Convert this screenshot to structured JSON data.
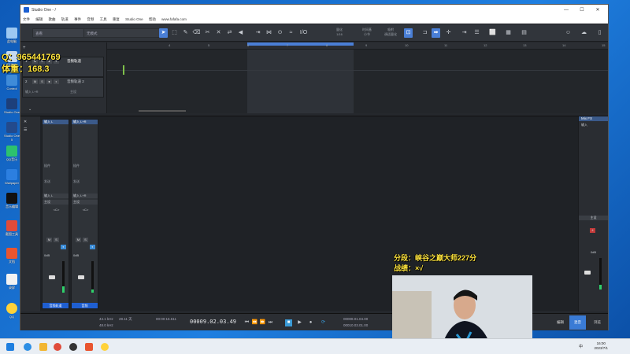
{
  "window": {
    "title": "Studio One - /",
    "min": "—",
    "max": "☐",
    "close": "✕"
  },
  "menu": [
    "文件",
    "编辑",
    "歌曲",
    "轨道",
    "事件",
    "音频",
    "工具",
    "重复",
    "Studio One",
    "帮助",
    "www.fafafa.com"
  ],
  "toolbar": {
    "field1": "查看",
    "field2": "无模式",
    "quant_label": "量化",
    "quant_value": "1/16",
    "timebase_label": "时间基",
    "timebase_value": "小节",
    "snap_label": "吸附",
    "snap_value": "调适量化"
  },
  "ruler": {
    "ticks": [
      "4",
      "5",
      "6",
      "7",
      "8",
      "9",
      "10",
      "11",
      "12",
      "13",
      "14",
      "15",
      "16",
      "17",
      "18",
      "19",
      "20",
      "21"
    ]
  },
  "tracks": [
    {
      "num": "1",
      "name": "音频轨道"
    },
    {
      "num": "2",
      "name": "音频轨道 2",
      "input": "输入 L+R",
      "out": "主设"
    }
  ],
  "overlay": {
    "qq": "Q：965441769",
    "weight": "体重：168.3",
    "rank": "分段：峡谷之巅大师227分",
    "record": "战绩：×√"
  },
  "mixer": {
    "insert_label": "插件",
    "sends_label": "发送",
    "channels": [
      {
        "name": "音频轨道",
        "input": "输入 L",
        "out": "主设",
        "pan": "<C>",
        "vol": "0dB"
      },
      {
        "name": "音频",
        "input": "输入 L+R",
        "out": "主设",
        "pan": "<C>",
        "vol": "0dB"
      }
    ],
    "right": {
      "title": "Mix FX",
      "input": "输入",
      "main": "主设",
      "vol": "0dB"
    }
  },
  "transport": {
    "rate": "44.1 kHz",
    "rate2": "48.0 kHz",
    "time1": "28.11 天",
    "time2": "00:00:16.611",
    "position": "00009.02.03.49",
    "loop_start": "00008.01.04.00",
    "loop_end": "00010.03.01.00",
    "tabs": [
      "编辑",
      "混音",
      "浏览"
    ]
  },
  "taskbar": {
    "time": "16:00",
    "date": "2023/7/1",
    "lang": "中"
  },
  "desktop_icons": [
    "此电脑",
    "回收站",
    "Control",
    "Studio One",
    "Studio One 5",
    "QQ音乐",
    "Wallpaper",
    "音乐编辑",
    "截图工具",
    "文档",
    "录屏",
    "QQ"
  ]
}
